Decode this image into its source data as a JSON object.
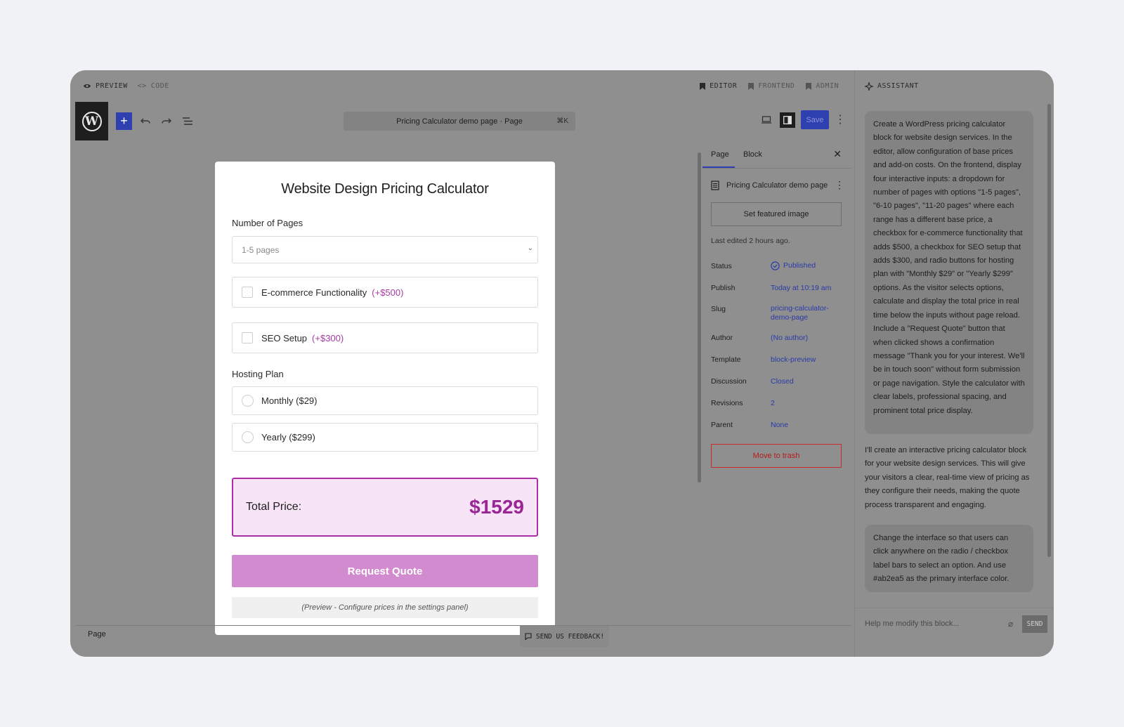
{
  "topbar": {
    "preview": "PREVIEW",
    "code": "CODE",
    "editor": "EDITOR",
    "frontend": "FRONTEND",
    "admin": "ADMIN"
  },
  "toolbar": {
    "wp_logo": "W",
    "add": "+",
    "doc_title": "Pricing Calculator demo page · Page",
    "shortcut": "⌘K",
    "save": "Save"
  },
  "calculator": {
    "title": "Website Design Pricing Calculator",
    "pages_label": "Number of Pages",
    "pages_value": "1-5 pages",
    "ecommerce_label": "E-commerce Functionality",
    "ecommerce_price": "(+$500)",
    "seo_label": "SEO Setup",
    "seo_price": "(+$300)",
    "hosting_label": "Hosting Plan",
    "monthly": "Monthly ($29)",
    "yearly": "Yearly ($299)",
    "total_label": "Total Price:",
    "total_value": "$1529",
    "quote_button": "Request Quote",
    "note": "(Preview - Configure prices in the settings panel)",
    "accent": "#ab2ea5"
  },
  "settings": {
    "tab_page": "Page",
    "tab_block": "Block",
    "page_name": "Pricing Calculator demo page",
    "featured": "Set featured image",
    "last_edited": "Last edited 2 hours ago.",
    "rows": [
      {
        "k": "Status",
        "v": "Published"
      },
      {
        "k": "Publish",
        "v": "Today at 10:19 am"
      },
      {
        "k": "Slug",
        "v": "pricing-calculator-demo-page"
      },
      {
        "k": "Author",
        "v": "(No author)"
      },
      {
        "k": "Template",
        "v": "block-preview"
      },
      {
        "k": "Discussion",
        "v": "Closed"
      },
      {
        "k": "Revisions",
        "v": "2"
      },
      {
        "k": "Parent",
        "v": "None"
      }
    ],
    "trash": "Move to trash"
  },
  "statusbar": {
    "page": "Page",
    "feedback": "SEND US FEEDBACK!"
  },
  "assistant": {
    "title": "ASSISTANT",
    "messages": [
      "Create a WordPress pricing calculator block for website design services. In the editor, allow configuration of base prices and add-on costs. On the frontend, display four interactive inputs: a dropdown for number of pages with options \"1-5 pages\", \"6-10 pages\", \"11-20 pages\" where each range has a different base price, a checkbox for e-commerce functionality that adds $500, a checkbox for SEO setup that adds $300, and radio buttons for hosting plan with \"Monthly $29\" or \"Yearly $299\" options. As the visitor selects options, calculate and display the total price in real time below the inputs without page reload. Include a \"Request Quote\" button that when clicked shows a confirmation message \"Thank you for your interest. We'll be in touch soon\" without form submission or page navigation. Style the calculator with clear labels, professional spacing, and prominent total price display.",
      "I'll create an interactive pricing calculator block for your website design services. This will give your visitors a clear, real-time view of pricing as they configure their needs, making the quote process transparent and engaging.",
      "Change the interface so that users can click anywhere on the radio / checkbox label bars to select an option. And use #ab2ea5 as the primary interface color."
    ],
    "input_placeholder": "Help me modify this block...",
    "send": "SEND"
  }
}
